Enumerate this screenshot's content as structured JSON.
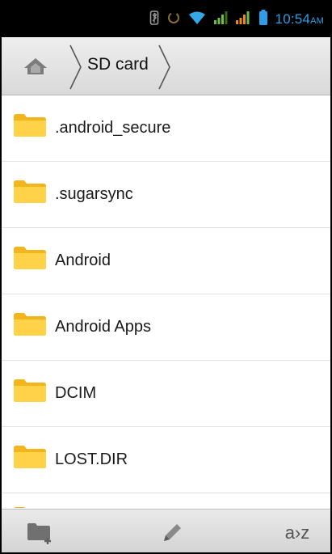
{
  "status_bar": {
    "time": "10:54",
    "ampm": "AM",
    "icons": [
      "bluetooth-icon",
      "sync-icon",
      "wifi-icon",
      "signal-icon",
      "signal-icon",
      "battery-icon"
    ],
    "accent_color": "#2f9de6"
  },
  "breadcrumb": {
    "home_icon": "home-icon",
    "current": "SD card"
  },
  "files": [
    {
      "name": ".android_secure",
      "icon": "folder-icon"
    },
    {
      "name": ".sugarsync",
      "icon": "folder-icon"
    },
    {
      "name": "Android",
      "icon": "folder-icon"
    },
    {
      "name": "Android Apps",
      "icon": "folder-icon"
    },
    {
      "name": "DCIM",
      "icon": "folder-icon"
    },
    {
      "name": "LOST.DIR",
      "icon": "folder-icon"
    }
  ],
  "toolbar": {
    "new_folder_icon": "new-folder-icon",
    "rename_icon": "pencil-icon",
    "sort_label": "a›z"
  }
}
